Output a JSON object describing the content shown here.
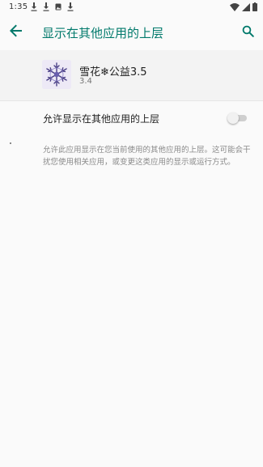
{
  "status_bar": {
    "time": "1:35",
    "notification_icons": [
      "download-icon",
      "download-icon",
      "picture-icon",
      "download-icon"
    ],
    "system_icons": [
      "wifi-icon",
      "signal-icon",
      "battery-icon"
    ]
  },
  "app_bar": {
    "title": "显示在其他应用的上层"
  },
  "app": {
    "name": "雪花❄公益3.5",
    "version": "3.4"
  },
  "setting": {
    "label": "允许显示在其他应用的上层",
    "enabled": false
  },
  "description": "允许此应用显示在您当前使用的其他应用的上层。这可能会干扰您使用相关应用，或变更这类应用的显示或运行方式。",
  "colors": {
    "accent": "#00796b",
    "background": "#fafafa",
    "header_background": "#f3f3f3"
  }
}
